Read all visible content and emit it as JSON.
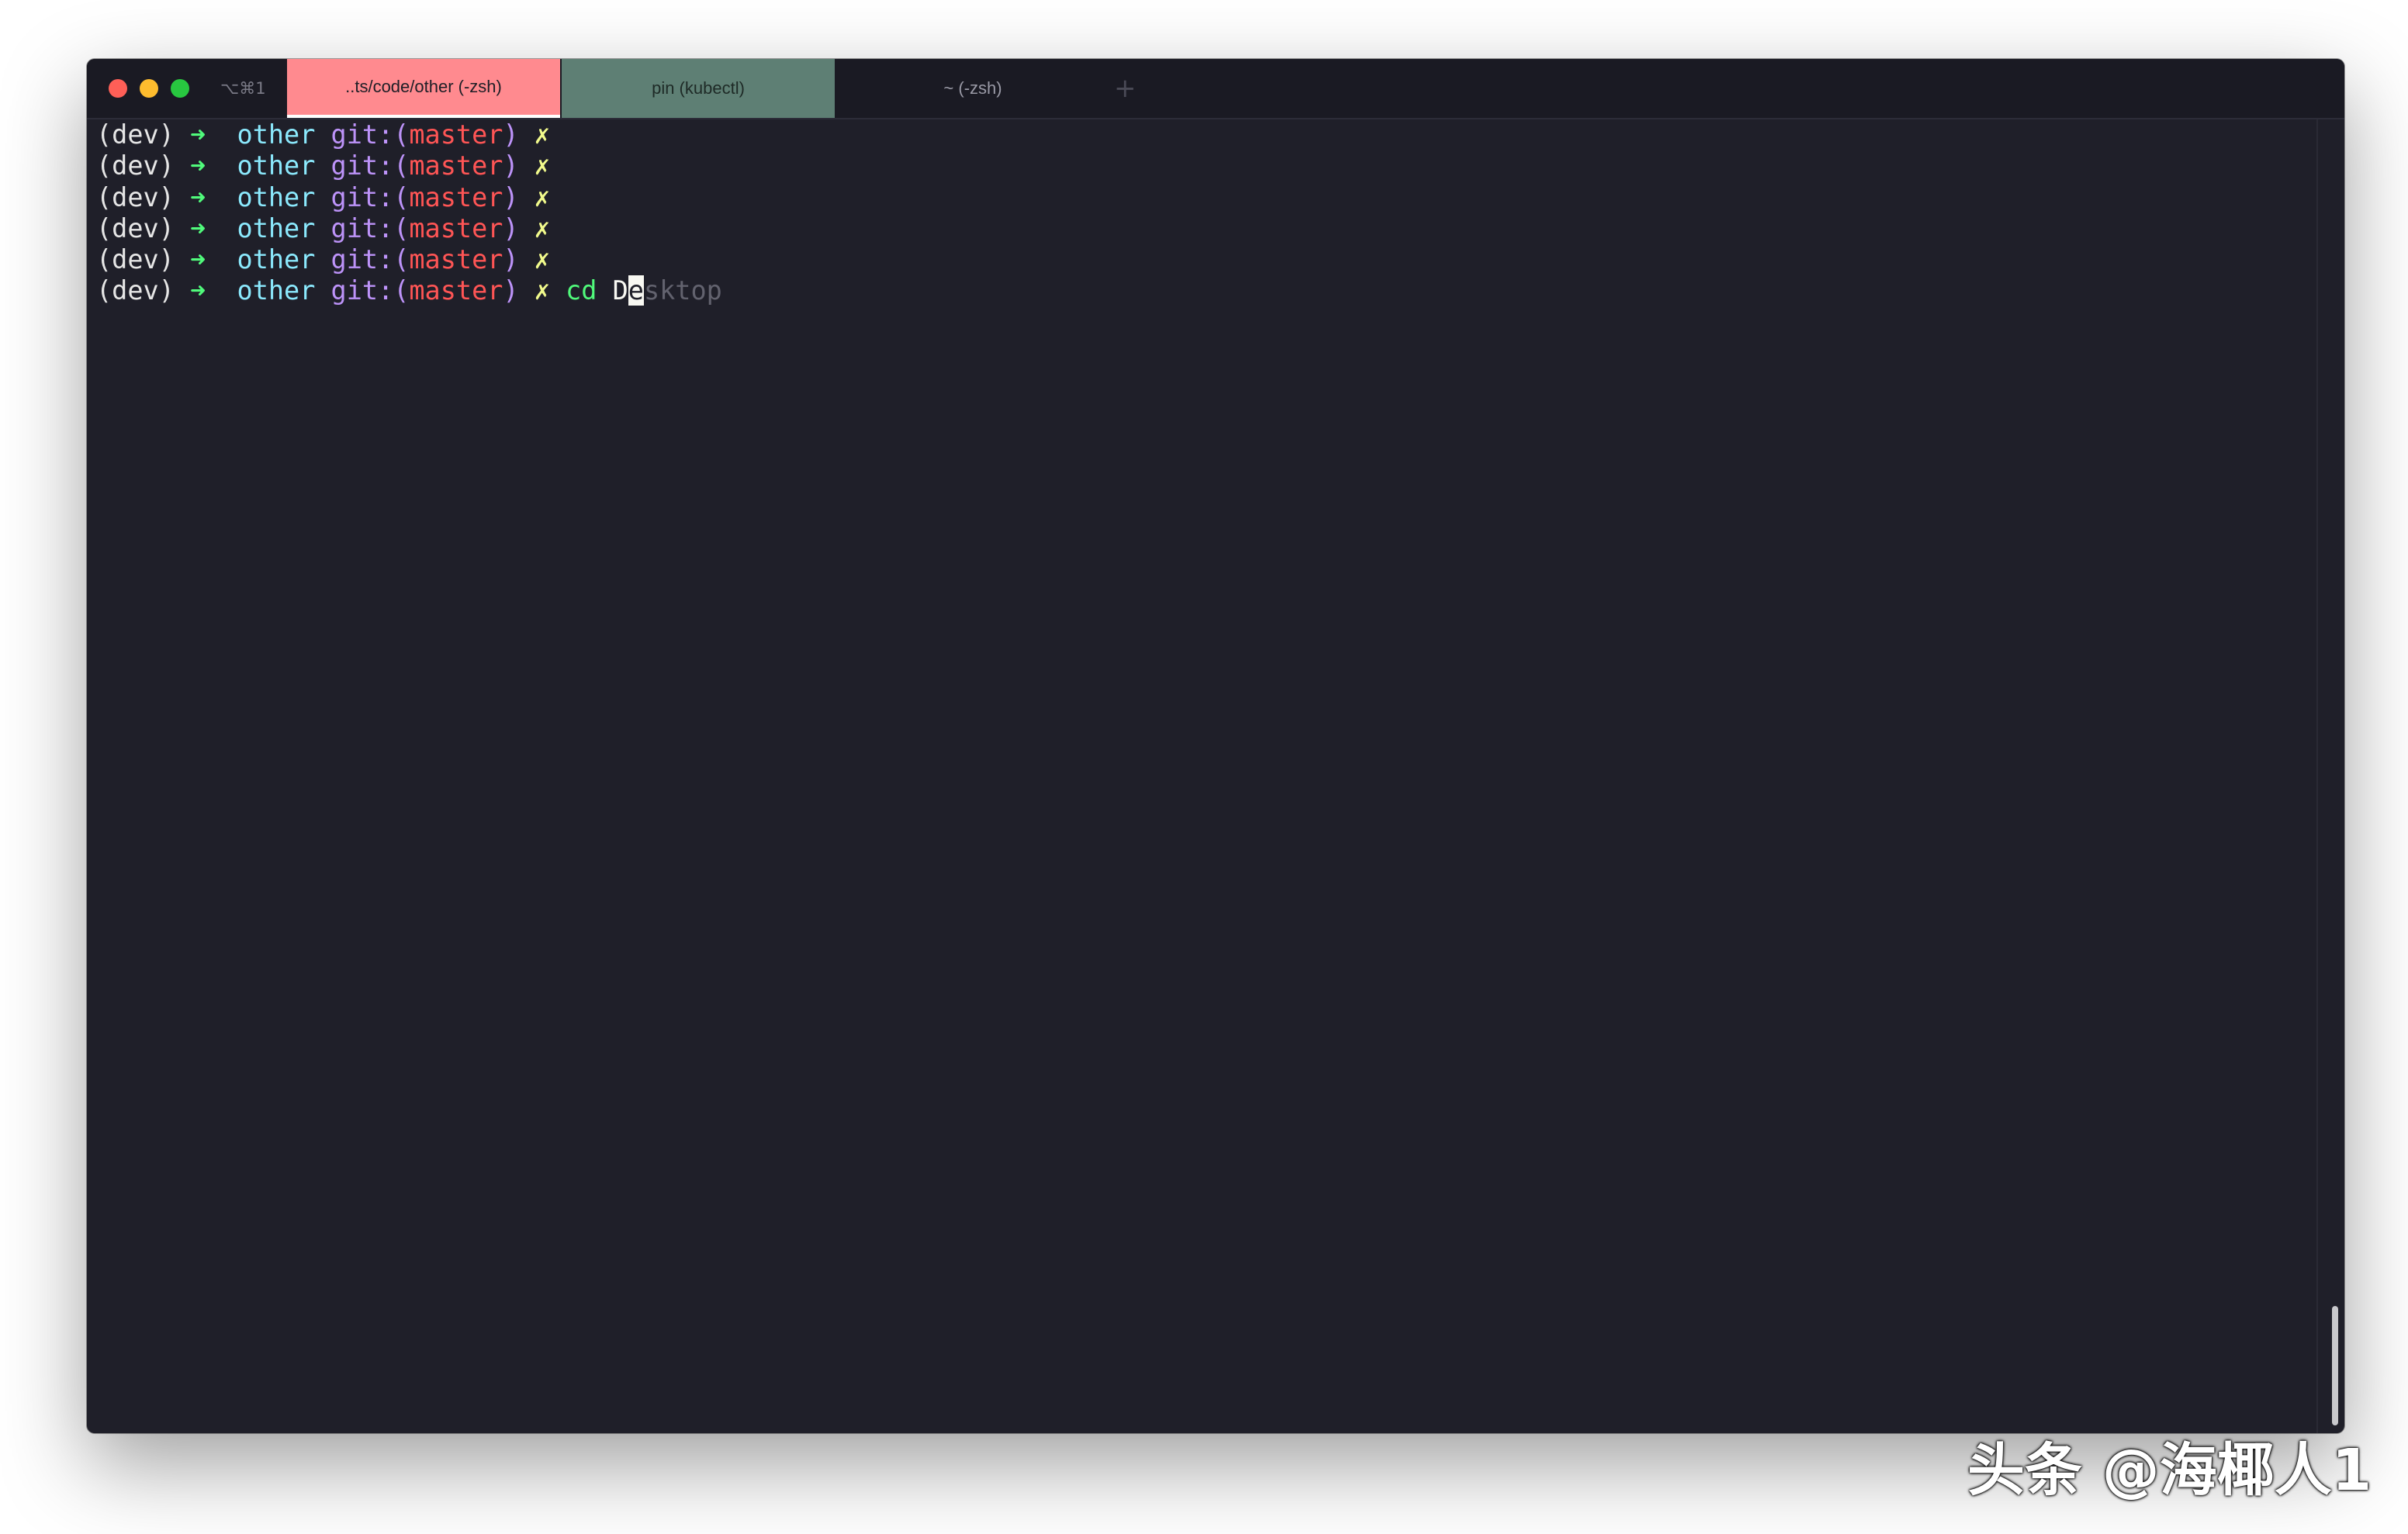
{
  "tabs": [
    {
      "label": "..ts/code/other (-zsh)",
      "active": true
    },
    {
      "label": "pin (kubectl)",
      "active": false
    },
    {
      "label": "~ (-zsh)",
      "active": false
    }
  ],
  "shortcut": "⌥⌘1",
  "new_tab_label": "+",
  "prompt": {
    "env": "(dev)",
    "arrow": "➜",
    "dir": "other",
    "git_prefix": "git:(",
    "branch": "master",
    "git_suffix": ")",
    "dirty": "✗"
  },
  "lines": [
    {},
    {},
    {},
    {},
    {},
    {
      "command": "cd",
      "typed": "D",
      "cursor_char": "e",
      "suggestion": "sktop"
    }
  ],
  "watermark": "头条 @海椰人1",
  "colors": {
    "background": "#1f1f29",
    "active_tab": "#ff8a8f",
    "second_tab": "#5e7f74",
    "arrow": "#50fa7b",
    "dir": "#8be9fd",
    "git": "#bd93f9",
    "branch": "#ff5555",
    "dirty": "#f1fa8c"
  }
}
